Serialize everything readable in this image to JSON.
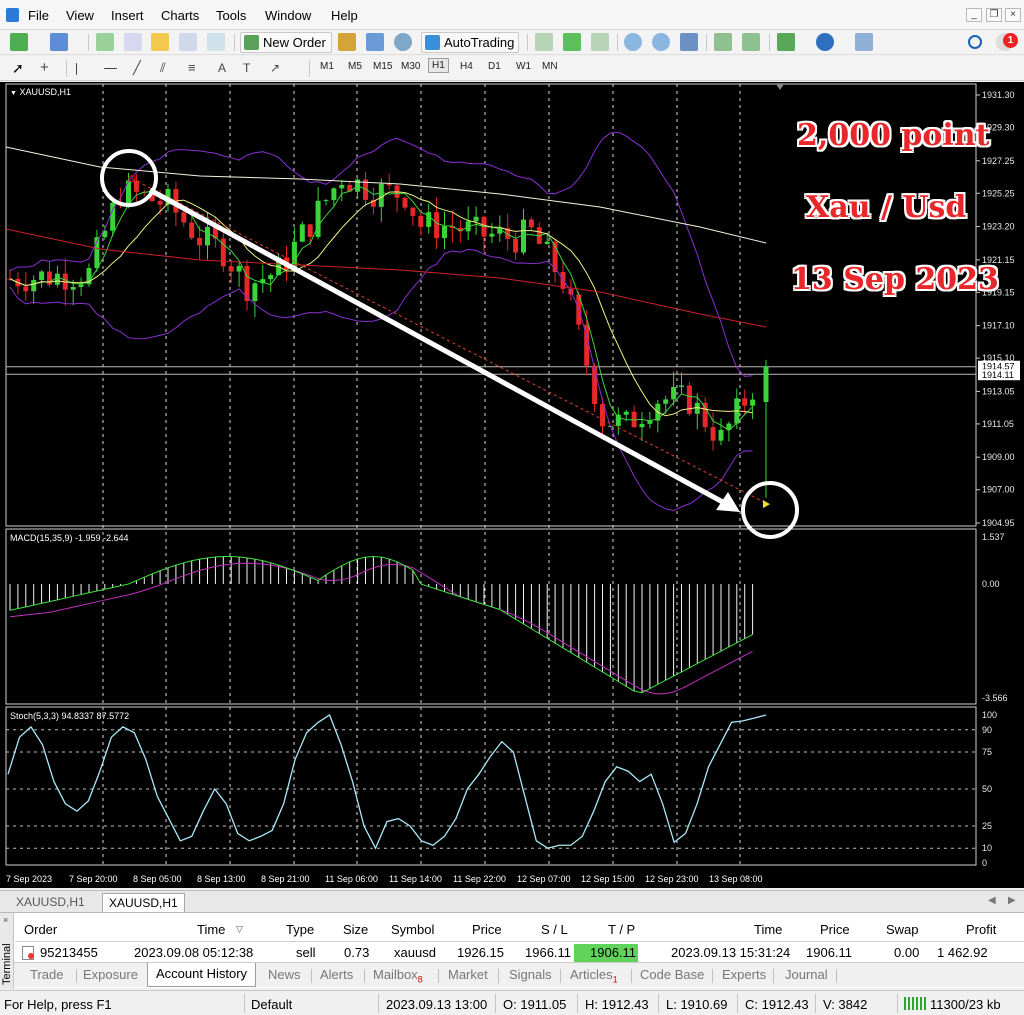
{
  "menu": {
    "items": [
      "File",
      "View",
      "Insert",
      "Charts",
      "Tools",
      "Window",
      "Help"
    ]
  },
  "toolbar": {
    "new_order_label": "New Order",
    "autotrading_label": "AutoTrading",
    "timeframes": [
      "M1",
      "M5",
      "M15",
      "M30",
      "H1",
      "H4",
      "D1",
      "W1",
      "MN"
    ],
    "active_timeframe": "H1",
    "notification_count": "1"
  },
  "chart": {
    "symbol_label": "XAUUSD,H1",
    "overlay_title": "2,000 point",
    "overlay_symbol": "Xau / Usd",
    "overlay_date": "13 Sep 2023",
    "price_axis": [
      "1931.30",
      "1929.30",
      "1927.25",
      "1925.25",
      "1923.20",
      "1921.15",
      "1919.15",
      "1917.10",
      "1915.10",
      "1913.05",
      "1911.05",
      "1909.00",
      "1907.00",
      "1904.95"
    ],
    "bid_label": "1914.57",
    "ask_label": "1914.11",
    "time_axis": [
      "7 Sep 2023",
      "7 Sep 20:00",
      "8 Sep 05:00",
      "8 Sep 13:00",
      "8 Sep 21:00",
      "11 Sep 06:00",
      "11 Sep 14:00",
      "11 Sep 22:00",
      "12 Sep 07:00",
      "12 Sep 15:00",
      "12 Sep 23:00",
      "13 Sep 08:00"
    ],
    "macd_label": "MACD(15,35,9) -1.959 -2.644",
    "macd_axis": [
      "1.537",
      "0.00",
      "-3.566"
    ],
    "stoch_label": "Stoch(5,3,3) 94.8337 87.5772",
    "stoch_axis": [
      "100",
      "90",
      "75",
      "50",
      "25",
      "10",
      "0"
    ],
    "colors": {
      "bull": "#3ad43a",
      "bear": "#e8272a",
      "ma_white": "#f4f4e0",
      "ma_red": "#d0202a",
      "bands": "#8a2fd0",
      "fast_ma": "#f0f080",
      "macd_signal": "#c030c0",
      "macd_line": "#40e040",
      "stoch": "#a8e8f8"
    }
  },
  "chart_tabs": [
    "XAUUSD,H1",
    "XAUUSD,H1"
  ],
  "terminal": {
    "side_label": "Terminal",
    "columns": [
      "Order",
      "Time",
      "Type",
      "Size",
      "Symbol",
      "Price",
      "S / L",
      "T / P",
      "Time",
      "Price",
      "Swap",
      "Profit"
    ],
    "row": {
      "order": "95213455",
      "open_time": "2023.09.08 05:12:38",
      "type": "sell",
      "size": "0.73",
      "symbol": "xauusd",
      "open_price": "1926.15",
      "sl": "1966.11",
      "tp": "1906.11",
      "close_time": "2023.09.13 15:31:24",
      "close_price": "1906.11",
      "swap": "0.00",
      "profit": "1 462.92"
    },
    "tabs": [
      "Trade",
      "Exposure",
      "Account History",
      "News",
      "Alerts",
      "Mailbox",
      "Market",
      "Signals",
      "Articles",
      "Code Base",
      "Experts",
      "Journal"
    ],
    "mailbox_count": "8",
    "articles_count": "1",
    "active_tab": "Account History"
  },
  "statusbar": {
    "help": "For Help, press F1",
    "profile": "Default",
    "datetime": "2023.09.13 13:00",
    "open": "O: 1911.05",
    "high": "H: 1912.43",
    "low": "L: 1910.69",
    "close": "C: 1912.43",
    "volume": "V: 3842",
    "traffic": "11300/23 kb"
  }
}
